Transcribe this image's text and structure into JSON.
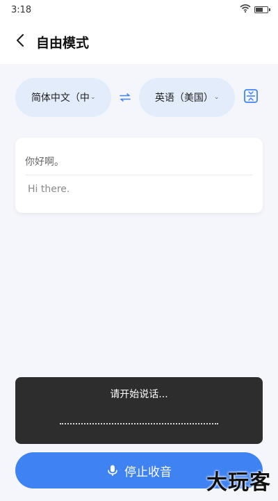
{
  "status_bar": {
    "time": "3:18"
  },
  "header": {
    "title": "自由模式"
  },
  "languages": {
    "source": "简体中文（中",
    "target": "英语（美国）"
  },
  "translation": {
    "source_text": "你好啊。",
    "target_text": "Hi there."
  },
  "listening": {
    "prompt": "请开始说话..."
  },
  "stop_button": {
    "label": "停止收音"
  },
  "watermark": "大玩客",
  "colors": {
    "accent": "#3f83f2",
    "pill_bg": "#e3ecfb",
    "panel_bg": "#2d2d2d"
  },
  "icons": {
    "back": "chevron-left-icon",
    "swap": "swap-arrows-icon",
    "layout": "split-view-icon",
    "mic": "microphone-icon",
    "wifi": "wifi-icon",
    "battery": "battery-icon"
  }
}
